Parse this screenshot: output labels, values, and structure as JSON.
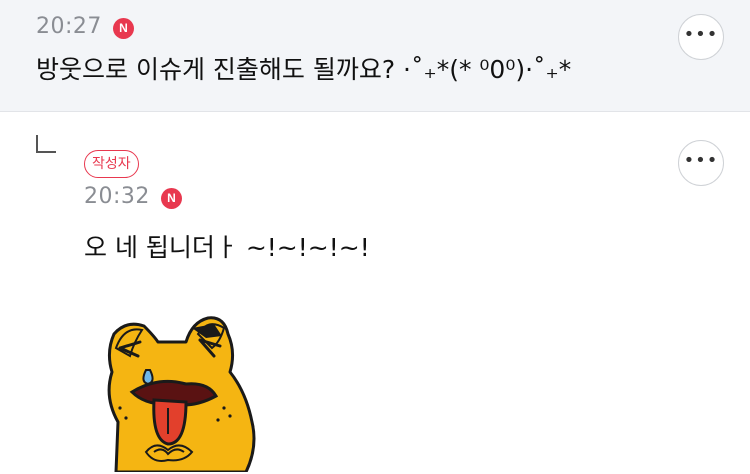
{
  "parent_comment": {
    "time": "20:27",
    "badge": "N",
    "text": "방웃으로 이슈게 진출해도 될까요? ·˚₊*(* ⁰0⁰)·˚₊*",
    "more": "•••"
  },
  "reply": {
    "author_badge": "작성자",
    "time": "20:32",
    "badge": "N",
    "text": "오 네 됩니더ㅏ ~!~!~!~!",
    "more": "•••",
    "sticker": "tongue-out-bear-sticker"
  },
  "colors": {
    "accent_red": "#e8384f",
    "top_bg": "#f3f5f8",
    "sticker_yellow": "#f5b512"
  }
}
